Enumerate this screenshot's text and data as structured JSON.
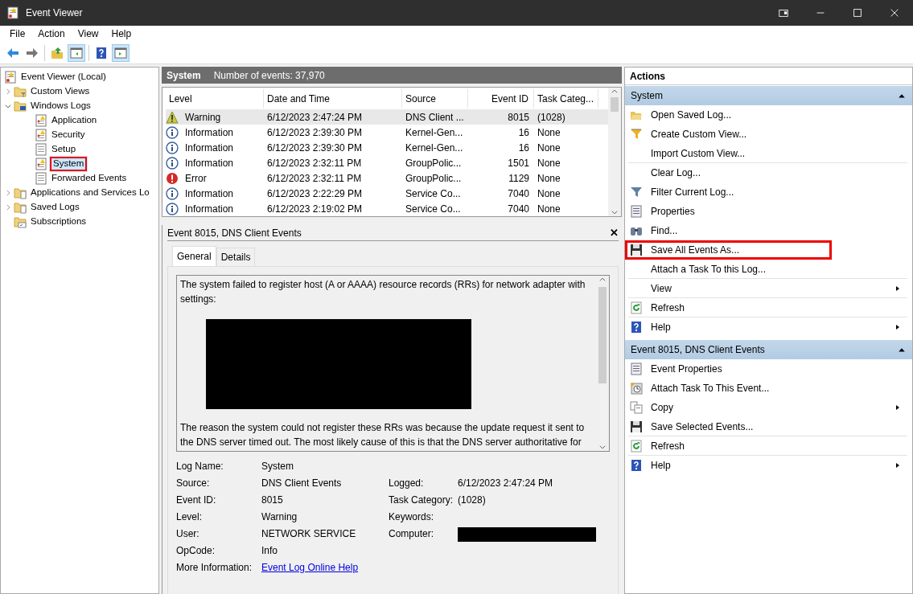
{
  "window": {
    "title": "Event Viewer"
  },
  "menu": [
    "File",
    "Action",
    "View",
    "Help"
  ],
  "toolbar": [
    {
      "kind": "back",
      "pressed": false
    },
    {
      "kind": "forward",
      "pressed": false
    },
    {
      "kind": "up-folder",
      "pressed": false
    },
    {
      "kind": "tree-pane",
      "pressed": true
    },
    {
      "kind": "help",
      "pressed": false
    },
    {
      "kind": "action-pane",
      "pressed": true
    }
  ],
  "tree": [
    {
      "label": "Event Viewer (Local)",
      "kind": "root",
      "selected": false,
      "highlighted": false,
      "children": [
        {
          "label": "Custom Views",
          "kind": "folder-filter",
          "expanded": false,
          "selected": false,
          "highlighted": false
        },
        {
          "label": "Windows Logs",
          "kind": "folder-pc",
          "expanded": true,
          "selected": false,
          "highlighted": false,
          "children": [
            {
              "label": "Application",
              "kind": "log-warn",
              "selected": false,
              "highlighted": false
            },
            {
              "label": "Security",
              "kind": "log-warn",
              "selected": false,
              "highlighted": false
            },
            {
              "label": "Setup",
              "kind": "log-plain",
              "selected": false,
              "highlighted": false
            },
            {
              "label": "System",
              "kind": "log-warn",
              "selected": true,
              "highlighted": true
            },
            {
              "label": "Forwarded Events",
              "kind": "log-plain",
              "selected": false,
              "highlighted": false
            }
          ]
        },
        {
          "label": "Applications and Services Lo",
          "kind": "folder-doc",
          "expanded": false,
          "selected": false,
          "highlighted": false
        },
        {
          "label": "Saved Logs",
          "kind": "folder-doc",
          "expanded": false,
          "selected": false,
          "highlighted": false
        },
        {
          "label": "Subscriptions",
          "kind": "folder-sub",
          "selected": false,
          "highlighted": false
        }
      ]
    }
  ],
  "log_header": {
    "name": "System",
    "count": "Number of events: 37,970"
  },
  "events": {
    "columns": [
      "Level",
      "Date and Time",
      "Source",
      "Event ID",
      "Task Categ..."
    ],
    "rows": [
      {
        "kind": "warning",
        "level": "Warning",
        "date": "6/12/2023 2:47:24 PM",
        "source": "DNS Client ...",
        "event_id": "8015",
        "category": "(1028)",
        "selected": true
      },
      {
        "kind": "information",
        "level": "Information",
        "date": "6/12/2023 2:39:30 PM",
        "source": "Kernel-Gen...",
        "event_id": "16",
        "category": "None",
        "selected": false
      },
      {
        "kind": "information",
        "level": "Information",
        "date": "6/12/2023 2:39:30 PM",
        "source": "Kernel-Gen...",
        "event_id": "16",
        "category": "None",
        "selected": false
      },
      {
        "kind": "information",
        "level": "Information",
        "date": "6/12/2023 2:32:11 PM",
        "source": "GroupPolic...",
        "event_id": "1501",
        "category": "None",
        "selected": false
      },
      {
        "kind": "error",
        "level": "Error",
        "date": "6/12/2023 2:32:11 PM",
        "source": "GroupPolic...",
        "event_id": "1129",
        "category": "None",
        "selected": false
      },
      {
        "kind": "information",
        "level": "Information",
        "date": "6/12/2023 2:22:29 PM",
        "source": "Service Co...",
        "event_id": "7040",
        "category": "None",
        "selected": false
      },
      {
        "kind": "information",
        "level": "Information",
        "date": "6/12/2023 2:19:02 PM",
        "source": "Service Co...",
        "event_id": "7040",
        "category": "None",
        "selected": false
      }
    ]
  },
  "details": {
    "title": "Event 8015, DNS Client Events",
    "close": "✕",
    "tabs": [
      {
        "label": "General",
        "selected": true
      },
      {
        "label": "Details",
        "selected": false
      }
    ],
    "description": [
      "The system failed to register host (A or AAAA) resource records (RRs) for network adapter with settings:",
      "The reason the system could not register these RRs was because the update request it sent to the DNS server timed out. The most likely cause of this is that the DNS server authoritative for"
    ],
    "description_redacted": true,
    "fields": [
      {
        "label": "Log Name:",
        "value": "System"
      },
      {
        "label": "Source:",
        "value": "DNS Client Events",
        "right_label": "Logged:",
        "right_value": "6/12/2023 2:47:24 PM"
      },
      {
        "label": "Event ID:",
        "value": "8015",
        "right_label": "Task Category:",
        "right_value": "(1028)"
      },
      {
        "label": "Level:",
        "value": "Warning",
        "right_label": "Keywords:"
      },
      {
        "label": "User:",
        "value": "NETWORK SERVICE",
        "right_label": "Computer:",
        "right_redacted": true
      },
      {
        "label": "OpCode:",
        "value": "Info"
      },
      {
        "label": "More Information:",
        "link": "Event Log Online Help"
      }
    ]
  },
  "actions": {
    "title": "Actions",
    "sections": [
      {
        "title": "System",
        "expanded": true,
        "items": [
          {
            "label": "Open Saved Log...",
            "kind": "open-folder"
          },
          {
            "label": "Create Custom View...",
            "kind": "funnel-star"
          },
          {
            "label": "Import Custom View...",
            "divider_after": true
          },
          {
            "label": "Clear Log..."
          },
          {
            "label": "Filter Current Log...",
            "kind": "funnel"
          },
          {
            "label": "Properties",
            "kind": "properties"
          },
          {
            "label": "Find...",
            "kind": "binoculars"
          },
          {
            "label": "Save All Events As...",
            "kind": "floppy",
            "highlighted": true
          },
          {
            "label": "Attach a Task To this Log...",
            "divider_after": true
          },
          {
            "label": "View",
            "submenu": true,
            "divider_after": true
          },
          {
            "label": "Refresh",
            "kind": "refresh",
            "divider_after": true
          },
          {
            "label": "Help",
            "kind": "help",
            "submenu": true
          }
        ]
      },
      {
        "title": "Event 8015, DNS Client Events",
        "expanded": true,
        "items": [
          {
            "label": "Event Properties",
            "kind": "properties"
          },
          {
            "label": "Attach Task To This Event...",
            "kind": "clock"
          },
          {
            "label": "Copy",
            "kind": "copy",
            "submenu": true
          },
          {
            "label": "Save Selected Events...",
            "kind": "floppy",
            "divider_after": true
          },
          {
            "label": "Refresh",
            "kind": "refresh",
            "divider_after": true
          },
          {
            "label": "Help",
            "kind": "help",
            "submenu": true
          }
        ]
      }
    ]
  }
}
